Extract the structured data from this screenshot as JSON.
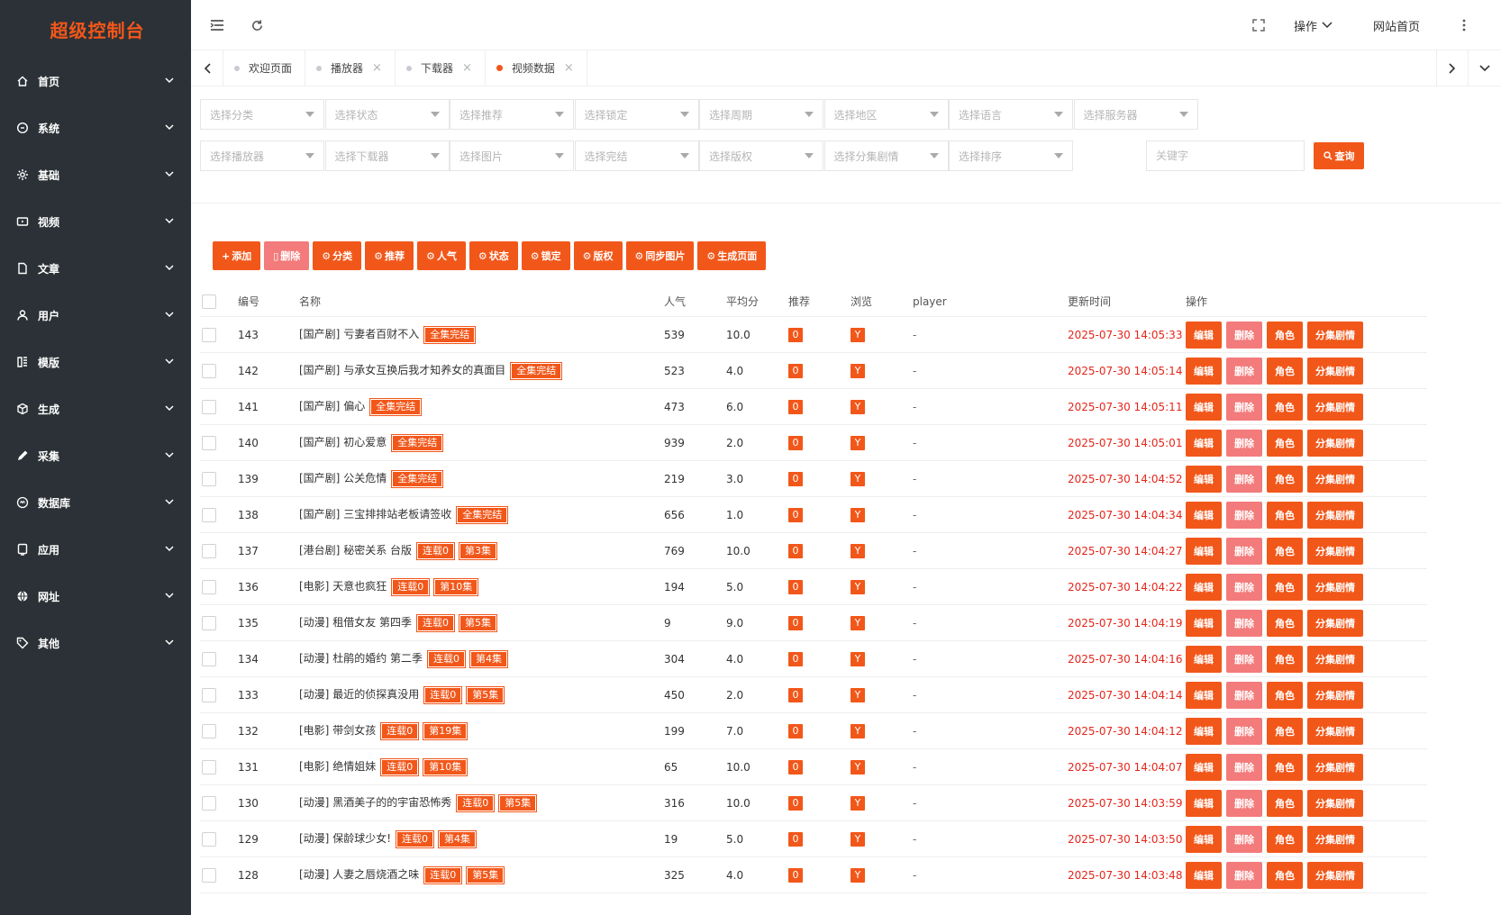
{
  "app": {
    "title": "超级控制台"
  },
  "colors": {
    "accent": "#f2571a",
    "light_accent": "#f37b7b",
    "sidebar_bg": "#2b3136",
    "time_red": "#e4261b"
  },
  "sidebar": {
    "items": [
      {
        "label": "首页",
        "icon": "home-icon"
      },
      {
        "label": "系统",
        "icon": "settings-circle-icon"
      },
      {
        "label": "基础",
        "icon": "gear-icon"
      },
      {
        "label": "视频",
        "icon": "video-icon"
      },
      {
        "label": "文章",
        "icon": "document-icon"
      },
      {
        "label": "用户",
        "icon": "user-icon"
      },
      {
        "label": "模版",
        "icon": "template-icon"
      },
      {
        "label": "生成",
        "icon": "cube-icon"
      },
      {
        "label": "采集",
        "icon": "pen-icon"
      },
      {
        "label": "数据库",
        "icon": "database-icon"
      },
      {
        "label": "应用",
        "icon": "app-icon"
      },
      {
        "label": "网址",
        "icon": "globe-icon"
      },
      {
        "label": "其他",
        "icon": "tag-icon"
      }
    ]
  },
  "topbar": {
    "operate_label": "操作",
    "site_home_label": "网站首页"
  },
  "tabs": [
    {
      "label": "欢迎页面",
      "closable": false,
      "active": false
    },
    {
      "label": "播放器",
      "closable": true,
      "active": false
    },
    {
      "label": "下载器",
      "closable": true,
      "active": false
    },
    {
      "label": "视频数据",
      "closable": true,
      "active": true
    }
  ],
  "filters": {
    "row1": [
      "选择分类",
      "选择状态",
      "选择推荐",
      "选择锁定",
      "选择周期",
      "选择地区",
      "选择语言",
      "选择服务器"
    ],
    "row2": [
      "选择播放器",
      "选择下载器",
      "选择图片",
      "选择完结",
      "选择版权",
      "选择分集剧情",
      "选择排序"
    ],
    "keyword_placeholder": "关键字",
    "query_label": "查询"
  },
  "actions": [
    "添加",
    "删除",
    "分类",
    "推荐",
    "人气",
    "状态",
    "锁定",
    "版权",
    "同步图片",
    "生成页面"
  ],
  "table": {
    "headers": {
      "id": "编号",
      "name": "名称",
      "hits": "人气",
      "score": "平均分",
      "rec": "推荐",
      "browse": "浏览",
      "player": "player",
      "updated": "更新时间",
      "ops": "操作"
    },
    "op_labels": {
      "edit": "编辑",
      "delete": "删除",
      "role": "角色",
      "episodes": "分集剧情"
    },
    "rows": [
      {
        "id": "143",
        "cat": "[国产剧]",
        "name": "亏妻者百财不入",
        "tags": [
          "全集完结"
        ],
        "hits": "539",
        "score": "10.0",
        "rec": "0",
        "browse": "Y",
        "player": "-",
        "time": "2025-07-30 14:05:33"
      },
      {
        "id": "142",
        "cat": "[国产剧]",
        "name": "与承女互换后我才知养女的真面目",
        "tags": [
          "全集完结"
        ],
        "hits": "523",
        "score": "4.0",
        "rec": "0",
        "browse": "Y",
        "player": "-",
        "time": "2025-07-30 14:05:14"
      },
      {
        "id": "141",
        "cat": "[国产剧]",
        "name": "偏心",
        "tags": [
          "全集完结"
        ],
        "hits": "473",
        "score": "6.0",
        "rec": "0",
        "browse": "Y",
        "player": "-",
        "time": "2025-07-30 14:05:11"
      },
      {
        "id": "140",
        "cat": "[国产剧]",
        "name": "初心爱意",
        "tags": [
          "全集完结"
        ],
        "hits": "939",
        "score": "2.0",
        "rec": "0",
        "browse": "Y",
        "player": "-",
        "time": "2025-07-30 14:05:01"
      },
      {
        "id": "139",
        "cat": "[国产剧]",
        "name": "公关危情",
        "tags": [
          "全集完结"
        ],
        "hits": "219",
        "score": "3.0",
        "rec": "0",
        "browse": "Y",
        "player": "-",
        "time": "2025-07-30 14:04:52"
      },
      {
        "id": "138",
        "cat": "[国产剧]",
        "name": "三宝排排站老板请签收",
        "tags": [
          "全集完结"
        ],
        "hits": "656",
        "score": "1.0",
        "rec": "0",
        "browse": "Y",
        "player": "-",
        "time": "2025-07-30 14:04:34"
      },
      {
        "id": "137",
        "cat": "[港台剧]",
        "name": "秘密关系 台版",
        "tags": [
          "连载0",
          "第3集"
        ],
        "hits": "769",
        "score": "10.0",
        "rec": "0",
        "browse": "Y",
        "player": "-",
        "time": "2025-07-30 14:04:27"
      },
      {
        "id": "136",
        "cat": "[电影]",
        "name": "天意也疯狂",
        "tags": [
          "连载0",
          "第10集"
        ],
        "hits": "194",
        "score": "5.0",
        "rec": "0",
        "browse": "Y",
        "player": "-",
        "time": "2025-07-30 14:04:22"
      },
      {
        "id": "135",
        "cat": "[动漫]",
        "name": "租借女友 第四季",
        "tags": [
          "连载0",
          "第5集"
        ],
        "hits": "9",
        "score": "9.0",
        "rec": "0",
        "browse": "Y",
        "player": "-",
        "time": "2025-07-30 14:04:19"
      },
      {
        "id": "134",
        "cat": "[动漫]",
        "name": "杜鹃的婚约 第二季",
        "tags": [
          "连载0",
          "第4集"
        ],
        "hits": "304",
        "score": "4.0",
        "rec": "0",
        "browse": "Y",
        "player": "-",
        "time": "2025-07-30 14:04:16"
      },
      {
        "id": "133",
        "cat": "[动漫]",
        "name": "最近的侦探真没用",
        "tags": [
          "连载0",
          "第5集"
        ],
        "hits": "450",
        "score": "2.0",
        "rec": "0",
        "browse": "Y",
        "player": "-",
        "time": "2025-07-30 14:04:14"
      },
      {
        "id": "132",
        "cat": "[电影]",
        "name": "带剑女孩",
        "tags": [
          "连载0",
          "第19集"
        ],
        "hits": "199",
        "score": "7.0",
        "rec": "0",
        "browse": "Y",
        "player": "-",
        "time": "2025-07-30 14:04:12"
      },
      {
        "id": "131",
        "cat": "[电影]",
        "name": "绝情姐妹",
        "tags": [
          "连载0",
          "第10集"
        ],
        "hits": "65",
        "score": "10.0",
        "rec": "0",
        "browse": "Y",
        "player": "-",
        "time": "2025-07-30 14:04:07"
      },
      {
        "id": "130",
        "cat": "[动漫]",
        "name": "黑酒美子的的宇宙恐怖秀",
        "tags": [
          "连载0",
          "第5集"
        ],
        "hits": "316",
        "score": "10.0",
        "rec": "0",
        "browse": "Y",
        "player": "-",
        "time": "2025-07-30 14:03:59"
      },
      {
        "id": "129",
        "cat": "[动漫]",
        "name": "保龄球少女!",
        "tags": [
          "连载0",
          "第4集"
        ],
        "hits": "19",
        "score": "5.0",
        "rec": "0",
        "browse": "Y",
        "player": "-",
        "time": "2025-07-30 14:03:50"
      },
      {
        "id": "128",
        "cat": "[动漫]",
        "name": "人妻之唇烧酒之味",
        "tags": [
          "连载0",
          "第5集"
        ],
        "hits": "325",
        "score": "4.0",
        "rec": "0",
        "browse": "Y",
        "player": "-",
        "time": "2025-07-30 14:03:48"
      }
    ]
  }
}
